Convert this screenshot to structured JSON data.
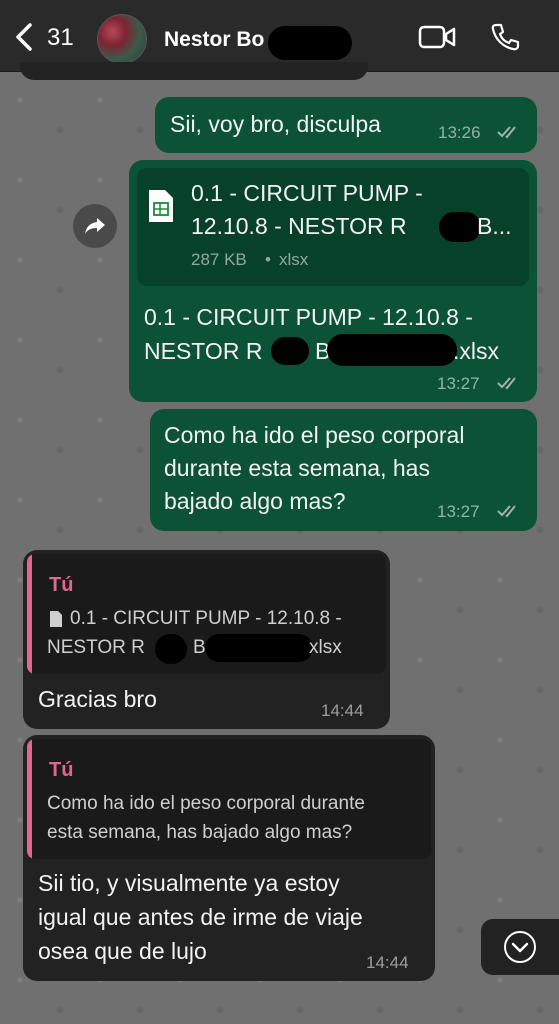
{
  "header": {
    "back_count": "31",
    "contact_name": "Nestor Bo",
    "video_icon": "video-call-icon",
    "phone_icon": "phone-icon"
  },
  "messages": [
    {
      "direction": "outgoing",
      "text": "Sii, voy bro, disculpa",
      "time": "13:26",
      "status": "read"
    },
    {
      "direction": "outgoing",
      "type": "file",
      "file_name_line1": "0.1 - CIRCUIT PUMP -",
      "file_name_line2_a": "12.10.8 - NESTOR R",
      "file_name_line2_b": "B...",
      "file_size": "287 KB",
      "file_ext": "xlsx",
      "caption_line1": "0.1 - CIRCUIT PUMP - 12.10.8 -",
      "caption_line2_a": "NESTOR R",
      "caption_line2_b": "B",
      "caption_line2_c": ".xlsx",
      "time": "13:27",
      "status": "read"
    },
    {
      "direction": "outgoing",
      "text_lines": [
        "Como ha ido el peso corporal",
        "durante esta semana, has",
        "bajado algo mas?"
      ],
      "time": "13:27",
      "status": "read"
    },
    {
      "direction": "incoming",
      "quote_author": "Tú",
      "quote_line1": "0.1 - CIRCUIT PUMP - 12.10.8 -",
      "quote_line2_a": "NESTOR R",
      "quote_line2_b": "B",
      "quote_line2_c": "xlsx",
      "text": "Gracias bro",
      "time": "14:44"
    },
    {
      "direction": "incoming",
      "quote_author": "Tú",
      "quote_lines": [
        "Como ha ido el peso corporal durante",
        "esta semana, has bajado algo mas?"
      ],
      "text_lines": [
        "Sii tio, y visualmente ya estoy",
        "igual que antes de irme de viaje",
        "osea que de lujo"
      ],
      "time": "14:44"
    }
  ],
  "colors": {
    "outgoing_bubble": "#0b5236",
    "incoming_bubble": "#222222",
    "quote_accent": "#e2668e",
    "read_ticks": "#9fb3a8"
  }
}
